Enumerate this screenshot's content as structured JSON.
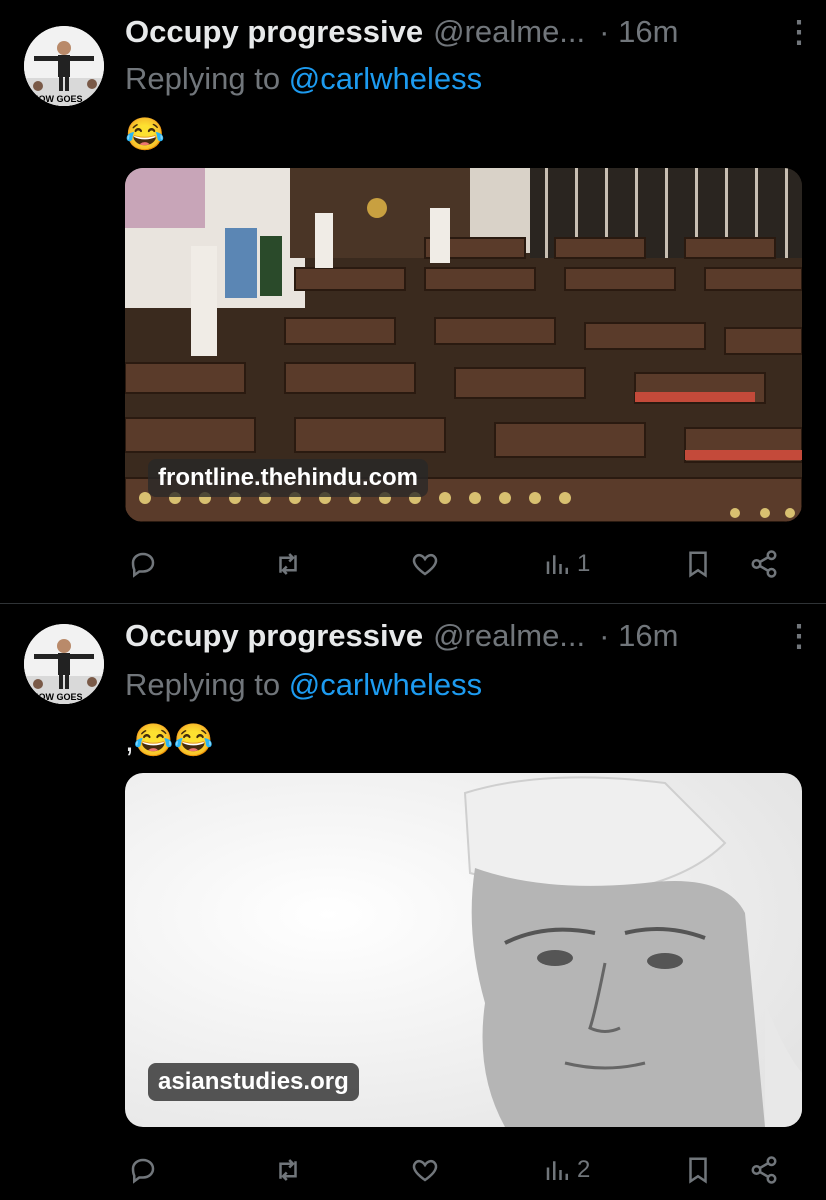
{
  "tweets": [
    {
      "name": "Occupy progressive",
      "handle": "@realme...",
      "time": "· 16m",
      "replying_prefix": "Replying to ",
      "replying_to": "@carlwheless",
      "text": "😂",
      "media_domain": "frontline.thehindu.com",
      "media_description": "Parliament chamber with rows of empty wooden benches",
      "stats": {
        "replies": "",
        "reposts": "",
        "likes": "",
        "views": "1"
      }
    },
    {
      "name": "Occupy progressive",
      "handle": "@realme...",
      "time": "· 16m",
      "replying_prefix": "Replying to ",
      "replying_to": "@carlwheless",
      "text": ",😂😂",
      "media_domain": "asianstudies.org",
      "media_description": "Black and white portrait of an elderly man in a white cap",
      "stats": {
        "replies": "",
        "reposts": "",
        "likes": "",
        "views": "2"
      }
    }
  ],
  "avatar_text": "SHOW GOES",
  "icons": [
    "reply-icon",
    "repost-icon",
    "like-icon",
    "views-icon",
    "bookmark-icon",
    "share-icon",
    "more-icon"
  ],
  "colors": {
    "background": "#000000",
    "text": "#e7e9ea",
    "muted": "#71767b",
    "link": "#1d9bf0"
  }
}
